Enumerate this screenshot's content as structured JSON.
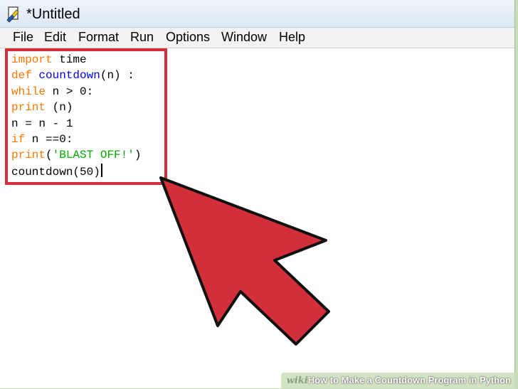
{
  "window": {
    "title": "*Untitled"
  },
  "menu": [
    "File",
    "Edit",
    "Format",
    "Run",
    "Options",
    "Window",
    "Help"
  ],
  "code": [
    [
      {
        "t": "import",
        "c": "kw"
      },
      {
        "t": " time",
        "c": ""
      }
    ],
    [
      {
        "t": "def",
        "c": "kw"
      },
      {
        "t": " ",
        "c": ""
      },
      {
        "t": "countdown",
        "c": "fn"
      },
      {
        "t": "(n) :",
        "c": ""
      }
    ],
    [
      {
        "t": "while",
        "c": "kw"
      },
      {
        "t": " n > 0:",
        "c": ""
      }
    ],
    [
      {
        "t": "print",
        "c": "kw"
      },
      {
        "t": " (n)",
        "c": ""
      }
    ],
    [
      {
        "t": "n = n - 1",
        "c": ""
      }
    ],
    [
      {
        "t": "if",
        "c": "kw"
      },
      {
        "t": " n ==0:",
        "c": ""
      }
    ],
    [
      {
        "t": "print",
        "c": "kw"
      },
      {
        "t": "(",
        "c": ""
      },
      {
        "t": "'BLAST OFF!'",
        "c": "st"
      },
      {
        "t": ")",
        "c": ""
      }
    ],
    [
      {
        "t": "countdown(50)",
        "c": ""
      }
    ]
  ],
  "colors": {
    "keyword": "#ff7700",
    "function_name": "#0000ff",
    "string": "#00aa00",
    "annotation_red": "#d32f3a"
  },
  "watermark": {
    "logo": "wiki",
    "how": "How",
    "rest": " to Make a Countdown Program in Python"
  },
  "icons": {
    "app": "python-idle-icon",
    "arrow": "pointer-arrow-icon"
  }
}
